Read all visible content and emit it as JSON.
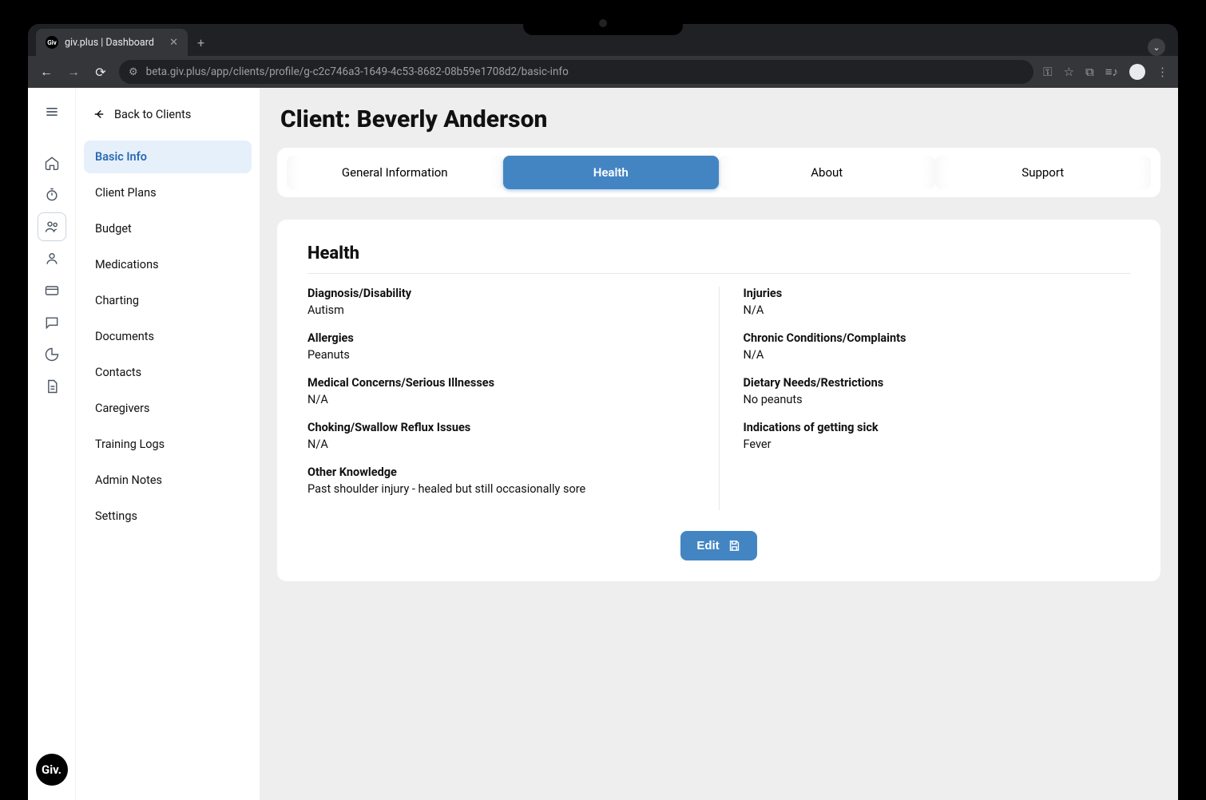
{
  "browser": {
    "tab_title": "giv.plus | Dashboard",
    "url": "beta.giv.plus/app/clients/profile/g-c2c746a3-1649-4c53-8682-08b59e1708d2/basic-info"
  },
  "rail": {
    "logo": "Giv."
  },
  "sidebar": {
    "back_label": "Back to Clients",
    "items": [
      "Basic Info",
      "Client Plans",
      "Budget",
      "Medications",
      "Charting",
      "Documents",
      "Contacts",
      "Caregivers",
      "Training Logs",
      "Admin Notes",
      "Settings"
    ]
  },
  "page": {
    "title": "Client: Beverly Anderson",
    "tabs": [
      "General Information",
      "Health",
      "About",
      "Support"
    ],
    "active_tab": "Health"
  },
  "panel": {
    "heading": "Health",
    "left": [
      {
        "label": "Diagnosis/Disability",
        "value": "Autism"
      },
      {
        "label": "Allergies",
        "value": "Peanuts"
      },
      {
        "label": "Medical Concerns/Serious Illnesses",
        "value": "N/A"
      },
      {
        "label": "Choking/Swallow Reflux Issues",
        "value": "N/A"
      },
      {
        "label": "Other Knowledge",
        "value": "Past shoulder injury - healed but still occasionally sore"
      }
    ],
    "right": [
      {
        "label": "Injuries",
        "value": "N/A"
      },
      {
        "label": "Chronic Conditions/Complaints",
        "value": "N/A"
      },
      {
        "label": "Dietary Needs/Restrictions",
        "value": "No peanuts"
      },
      {
        "label": "Indications of getting sick",
        "value": "Fever"
      }
    ],
    "edit_label": "Edit"
  }
}
